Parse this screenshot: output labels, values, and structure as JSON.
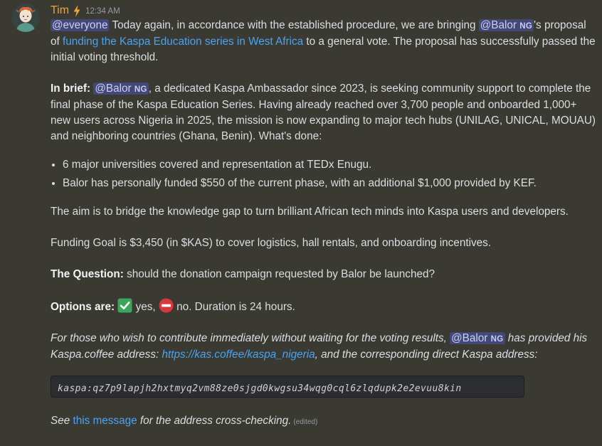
{
  "author": {
    "name": "Tim",
    "timestamp": "12:34 AM",
    "badge_icon": "lightning-bolt-icon"
  },
  "colors": {
    "author": "#f0a232",
    "link": "#4aa3f0",
    "mention_bg": "#5865f2",
    "check": "#3ba55c",
    "no_entry": "#da373c"
  },
  "p1": {
    "mention_everyone": "@everyone",
    "t1": " Today again, in accordance with the established procedure, we are bringing ",
    "mention_balor": "@Balor",
    "mention_tag": "NG",
    "t2": "'s proposal of ",
    "link": "funding the Kaspa Education series in West Africa",
    "t3": " to a general vote. The proposal has successfully passed the initial voting threshold."
  },
  "p2": {
    "bold": "In brief:",
    "mention_balor": "@Balor",
    "mention_tag": "NG",
    "text": ", a dedicated Kaspa Ambassador since 2023, is seeking community support to complete the final phase of the Kaspa Education Series. Having already reached over 3,700 people and onboarded 1,000+ new users across Nigeria in 2025, the mission is now expanding to major tech hubs (UNILAG, UNICAL, MOUAU) and neighboring countries (Ghana, Benin). What's done:"
  },
  "bullets": [
    "6 major universities covered and representation at TEDx Enugu.",
    "Balor has personally funded $550 of the current phase, with an additional $1,000 provided by KEF."
  ],
  "p3": "The aim is to bridge the knowledge gap to turn brilliant African tech minds into Kaspa users and developers.",
  "p4": "Funding Goal is $3,450 (in $KAS) to cover logistics, hall rentals, and onboarding incentives.",
  "p5": {
    "bold": "The Question:",
    "text": " should the donation campaign requested by Balor be launched?"
  },
  "p6": {
    "bold": "Options are:",
    "yes": " yes, ",
    "no": " no. Duration is 24 hours."
  },
  "p7": {
    "t1": "For those who wish to contribute immediately without waiting for the voting results, ",
    "mention_balor": "@Balor",
    "mention_tag": "NG",
    "t2": " has provided his Kaspa.coffee address:  ",
    "link": "https://kas.coffee/kaspa_nigeria",
    "t3": ", and the corresponding direct Kaspa address:"
  },
  "address": "kaspa:qz7p9lapjh2hxtmyq2vm88ze0sjgd0kwgsu34wqg0cql6zlqdupk2e2evuu8kin",
  "p8": {
    "t1": "See ",
    "link": "this message",
    "t2": " for the address cross-checking.",
    "edited": "(edited)"
  }
}
